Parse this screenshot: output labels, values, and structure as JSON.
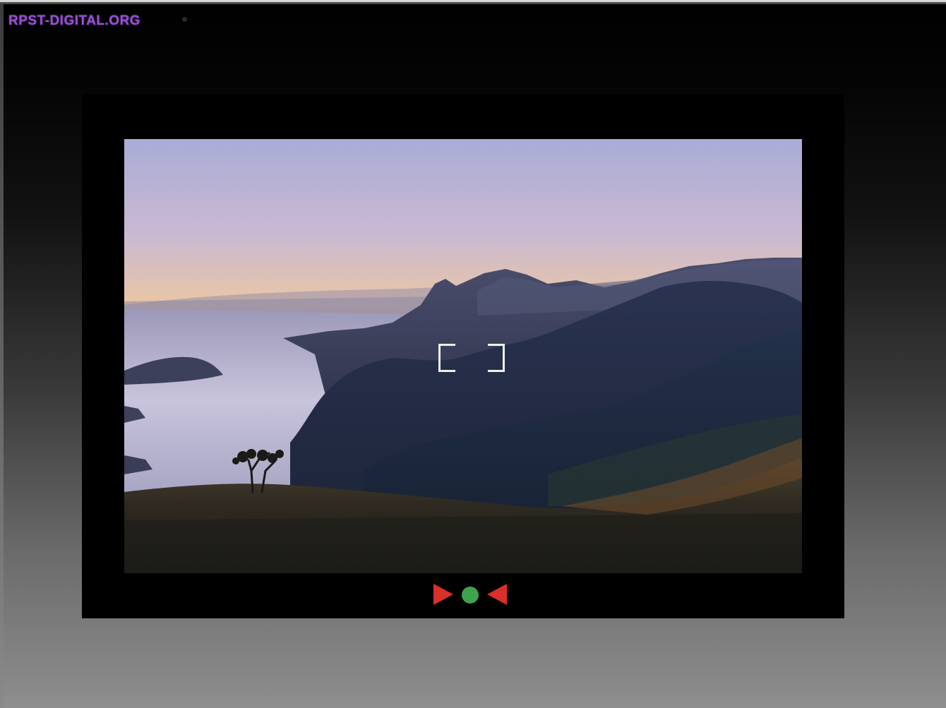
{
  "site": {
    "label": "RPST-DIGITAL.ORG",
    "label_color": "#9a4fd6"
  },
  "viewer": {
    "frame_color": "#000000",
    "photo": {
      "subject": "sunrise-mountains-above-sea-of-fog"
    },
    "focus_indicator_icon": "focus-brackets-icon",
    "controls": {
      "next_icon": "play-right-triangle-icon",
      "play_icon": "green-dot-icon",
      "prev_icon": "play-left-triangle-icon",
      "arrow_color": "#d9302a",
      "dot_color": "#3fa34d"
    }
  }
}
